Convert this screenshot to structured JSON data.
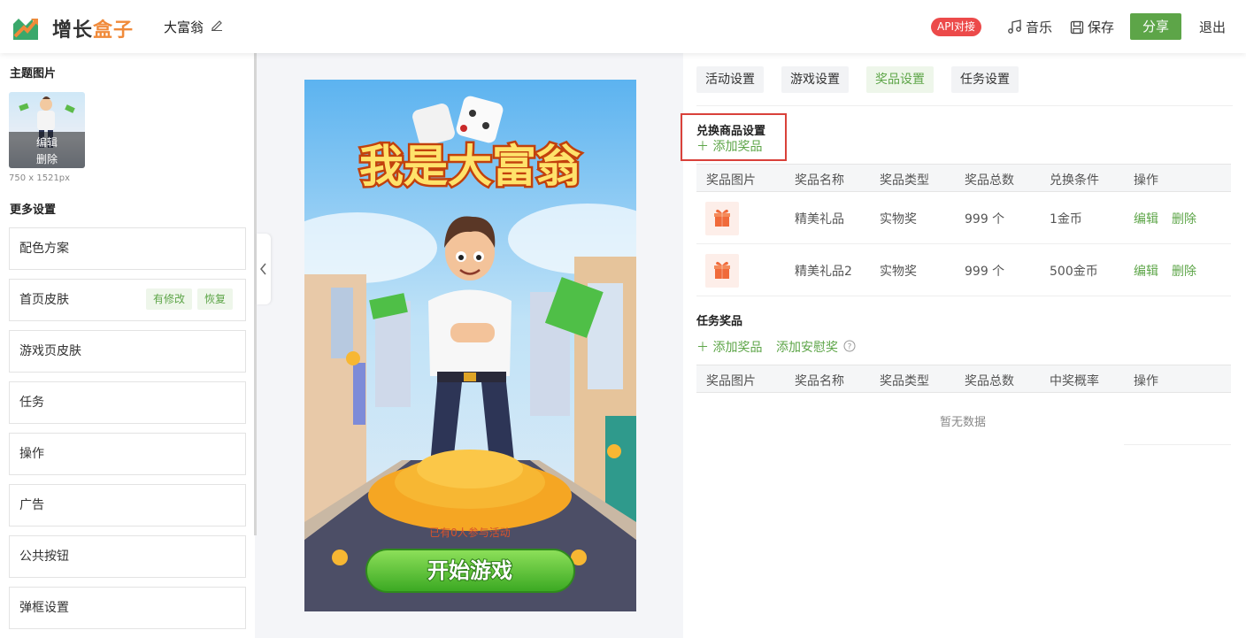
{
  "header": {
    "logo_part1": "增长",
    "logo_part2": "盒子",
    "app_name": "大富翁",
    "api_badge": "API对接",
    "music_label": "音乐",
    "save_label": "保存",
    "share_label": "分享",
    "exit_label": "退出"
  },
  "left": {
    "theme_title": "主题图片",
    "thumb_edit": "编辑",
    "thumb_delete": "删除",
    "size_note": "750 x 1521px",
    "more_title": "更多设置",
    "items": [
      {
        "label": "配色方案"
      },
      {
        "label": "首页皮肤",
        "tag1": "有修改",
        "tag2": "恢复"
      },
      {
        "label": "游戏页皮肤"
      },
      {
        "label": "任务"
      },
      {
        "label": "操作"
      },
      {
        "label": "广告"
      },
      {
        "label": "公共按钮"
      },
      {
        "label": "弹框设置"
      }
    ]
  },
  "poster": {
    "title": "我是大富翁",
    "participants": "已有0人参与活动",
    "start_button": "开始游戏"
  },
  "right": {
    "tabs": [
      {
        "label": "活动设置"
      },
      {
        "label": "游戏设置"
      },
      {
        "label": "奖品设置",
        "active": true
      },
      {
        "label": "任务设置"
      }
    ],
    "exchange_title": "兑换商品设置",
    "add_prize": "添加奖品",
    "exchange_columns": [
      "奖品图片",
      "奖品名称",
      "奖品类型",
      "奖品总数",
      "兑换条件",
      "操作"
    ],
    "exchange_rows": [
      {
        "name": "精美礼品",
        "type": "实物奖",
        "total": "999 个",
        "condition": "1金币",
        "edit": "编辑",
        "delete": "删除"
      },
      {
        "name": "精美礼品2",
        "type": "实物奖",
        "total": "999 个",
        "condition": "500金币",
        "edit": "编辑",
        "delete": "删除"
      }
    ],
    "task_title": "任务奖品",
    "task_add_prize": "添加奖品",
    "task_add_consolation": "添加安慰奖",
    "task_columns": [
      "奖品图片",
      "奖品名称",
      "奖品类型",
      "奖品总数",
      "中奖概率",
      "操作"
    ],
    "empty_text": "暂无数据"
  },
  "colors": {
    "brand_green": "#5da548",
    "brand_orange": "#f08a3a",
    "badge_red": "#ec4a4a",
    "highlight_red": "#d9413a"
  }
}
